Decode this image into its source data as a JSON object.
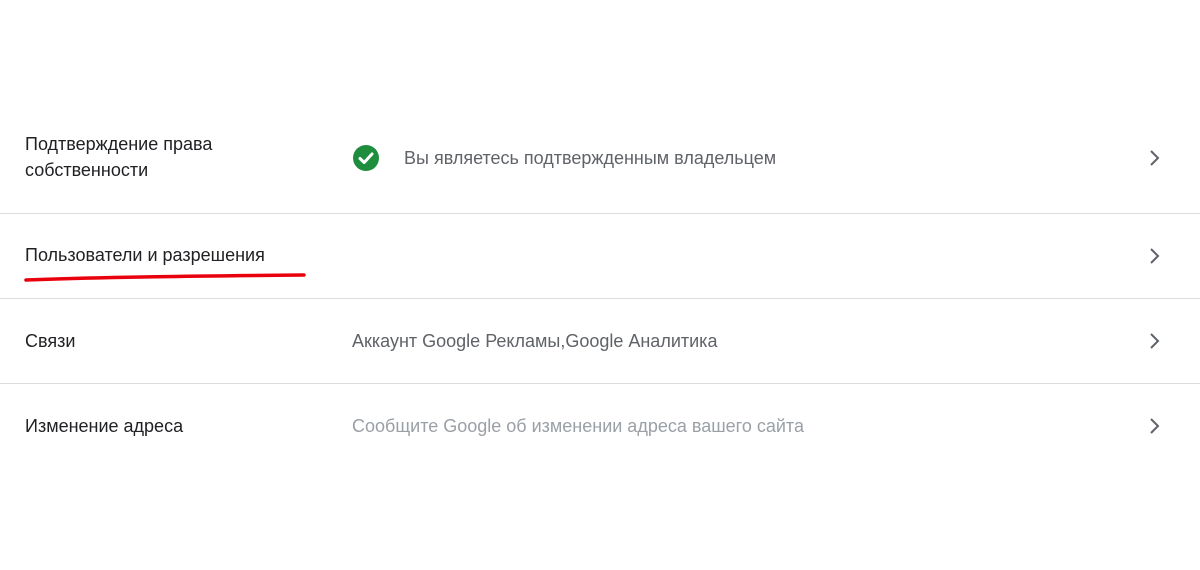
{
  "settings": {
    "rows": [
      {
        "label": "Подтверждение права собственности",
        "value": "Вы являетесь подтвержденным владельцем",
        "icon": "check-circle-icon",
        "icon_color": "#1e8e3e"
      },
      {
        "label": "Пользователи и разрешения",
        "value": ""
      },
      {
        "label": "Связи",
        "value": "Аккаунт Google Рекламы,Google Аналитика"
      },
      {
        "label": "Изменение адреса",
        "value": "Сообщите Google об изменении адреса вашего сайта"
      }
    ]
  },
  "colors": {
    "label_text": "#202124",
    "value_text": "#5f6368",
    "muted_text": "#9aa0a6",
    "divider": "#dadce0",
    "annotation_underline": "#e8000d"
  }
}
